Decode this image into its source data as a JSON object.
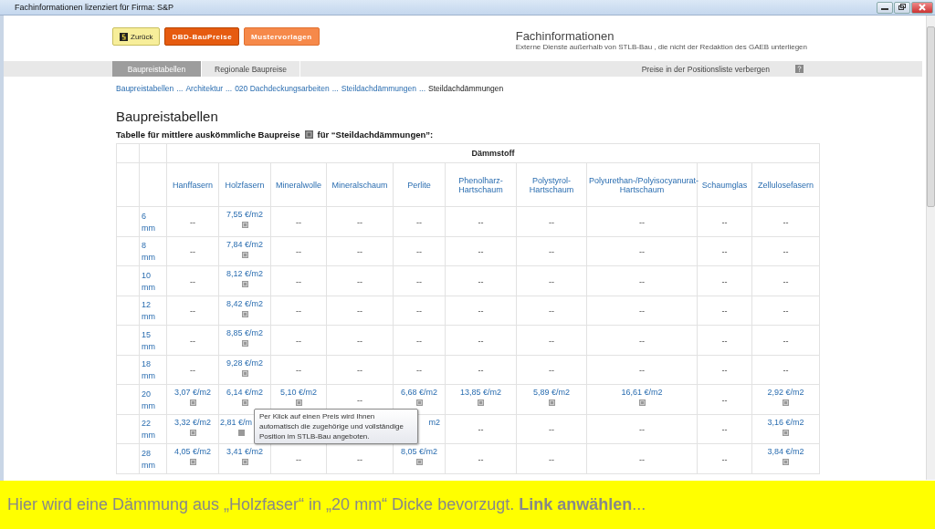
{
  "window": {
    "title": "Fachinformationen lizenziert für Firma: S&P"
  },
  "header_buttons": [
    {
      "label": "Zurück",
      "kind": "back"
    },
    {
      "label": "DBD-BauPreise",
      "kind": "primary"
    },
    {
      "label": "Mustervorlagen",
      "kind": "secondary"
    }
  ],
  "header": {
    "title": "Fachinformationen",
    "subtitle": "Externe Dienste außerhalb von  STLB-Bau , die nicht der Redaktion des GAEB unterliegen"
  },
  "tabs": [
    {
      "label": "Baupreistabellen",
      "selected": true
    },
    {
      "label": "Regionale Baupreise",
      "selected": false
    }
  ],
  "toggle_link": "Preise in der Positionsliste verbergen",
  "breadcrumb": [
    {
      "kind": "link",
      "text": "Baupreistabellen"
    },
    {
      "kind": "sep",
      "text": "..."
    },
    {
      "kind": "link",
      "text": "Architektur"
    },
    {
      "kind": "sep",
      "text": "..."
    },
    {
      "kind": "link",
      "text": "020 Dachdeckungsarbeiten"
    },
    {
      "kind": "sep",
      "text": "..."
    },
    {
      "kind": "link",
      "text": "Steildachdämmungen"
    },
    {
      "kind": "sep",
      "text": "..."
    },
    {
      "kind": "current",
      "text": "Steildachdämmungen"
    }
  ],
  "heading": "Baupreistabellen",
  "caption": {
    "before": "Tabelle für mittlere auskömmliche Baupreise",
    "after": "für “Steildachdämmungen”:"
  },
  "table": {
    "group_header": "Dämmstoff",
    "columns": [
      "Hanffasern",
      "Holzfasern",
      "Mineralwolle",
      "Mineralschaum",
      "Perlite",
      "Phenolharz-Hartschaum",
      "Polystyrol-Hartschaum",
      "Polyurethan-/Polyisocyanurat-Hartschaum",
      "Schaumglas",
      "Zellulosefasern"
    ],
    "rows": [
      {
        "size": "6",
        "unit": "mm",
        "cells": [
          {
            "kind": "dash",
            "text": "--"
          },
          {
            "kind": "price",
            "text": "7,55 €/m2",
            "info": true
          },
          {
            "kind": "dash",
            "text": "--"
          },
          {
            "kind": "dash",
            "text": "--"
          },
          {
            "kind": "dash",
            "text": "--"
          },
          {
            "kind": "dash",
            "text": "--"
          },
          {
            "kind": "dash",
            "text": "--"
          },
          {
            "kind": "dash",
            "text": "--"
          },
          {
            "kind": "dash",
            "text": "--"
          },
          {
            "kind": "dash",
            "text": "--"
          }
        ]
      },
      {
        "size": "8",
        "unit": "mm",
        "cells": [
          {
            "kind": "dash",
            "text": "--"
          },
          {
            "kind": "price",
            "text": "7,84 €/m2",
            "info": true
          },
          {
            "kind": "dash",
            "text": "--"
          },
          {
            "kind": "dash",
            "text": "--"
          },
          {
            "kind": "dash",
            "text": "--"
          },
          {
            "kind": "dash",
            "text": "--"
          },
          {
            "kind": "dash",
            "text": "--"
          },
          {
            "kind": "dash",
            "text": "--"
          },
          {
            "kind": "dash",
            "text": "--"
          },
          {
            "kind": "dash",
            "text": "--"
          }
        ]
      },
      {
        "size": "10",
        "unit": "mm",
        "cells": [
          {
            "kind": "dash",
            "text": "--"
          },
          {
            "kind": "price",
            "text": "8,12 €/m2",
            "info": true
          },
          {
            "kind": "dash",
            "text": "--"
          },
          {
            "kind": "dash",
            "text": "--"
          },
          {
            "kind": "dash",
            "text": "--"
          },
          {
            "kind": "dash",
            "text": "--"
          },
          {
            "kind": "dash",
            "text": "--"
          },
          {
            "kind": "dash",
            "text": "--"
          },
          {
            "kind": "dash",
            "text": "--"
          },
          {
            "kind": "dash",
            "text": "--"
          }
        ]
      },
      {
        "size": "12",
        "unit": "mm",
        "cells": [
          {
            "kind": "dash",
            "text": "--"
          },
          {
            "kind": "price",
            "text": "8,42 €/m2",
            "info": true
          },
          {
            "kind": "dash",
            "text": "--"
          },
          {
            "kind": "dash",
            "text": "--"
          },
          {
            "kind": "dash",
            "text": "--"
          },
          {
            "kind": "dash",
            "text": "--"
          },
          {
            "kind": "dash",
            "text": "--"
          },
          {
            "kind": "dash",
            "text": "--"
          },
          {
            "kind": "dash",
            "text": "--"
          },
          {
            "kind": "dash",
            "text": "--"
          }
        ]
      },
      {
        "size": "15",
        "unit": "mm",
        "cells": [
          {
            "kind": "dash",
            "text": "--"
          },
          {
            "kind": "price",
            "text": "8,85 €/m2",
            "info": true
          },
          {
            "kind": "dash",
            "text": "--"
          },
          {
            "kind": "dash",
            "text": "--"
          },
          {
            "kind": "dash",
            "text": "--"
          },
          {
            "kind": "dash",
            "text": "--"
          },
          {
            "kind": "dash",
            "text": "--"
          },
          {
            "kind": "dash",
            "text": "--"
          },
          {
            "kind": "dash",
            "text": "--"
          },
          {
            "kind": "dash",
            "text": "--"
          }
        ]
      },
      {
        "size": "18",
        "unit": "mm",
        "cells": [
          {
            "kind": "dash",
            "text": "--"
          },
          {
            "kind": "price",
            "text": "9,28 €/m2",
            "info": true
          },
          {
            "kind": "dash",
            "text": "--"
          },
          {
            "kind": "dash",
            "text": "--"
          },
          {
            "kind": "dash",
            "text": "--"
          },
          {
            "kind": "dash",
            "text": "--"
          },
          {
            "kind": "dash",
            "text": "--"
          },
          {
            "kind": "dash",
            "text": "--"
          },
          {
            "kind": "dash",
            "text": "--"
          },
          {
            "kind": "dash",
            "text": "--"
          }
        ]
      },
      {
        "size": "20",
        "unit": "mm",
        "cells": [
          {
            "kind": "price",
            "text": "3,07 €/m2",
            "info": true
          },
          {
            "kind": "price",
            "text": "6,14 €/m2",
            "info": true
          },
          {
            "kind": "price",
            "text": "5,10 €/m2",
            "info": true
          },
          {
            "kind": "dash",
            "text": "--"
          },
          {
            "kind": "price",
            "text": "6,68 €/m2",
            "info": true
          },
          {
            "kind": "price",
            "text": "13,85 €/m2",
            "info": true
          },
          {
            "kind": "price",
            "text": "5,89 €/m2",
            "info": true
          },
          {
            "kind": "price",
            "text": "16,61 €/m2",
            "info": true
          },
          {
            "kind": "dash",
            "text": "--"
          },
          {
            "kind": "price",
            "text": "2,92 €/m2",
            "info": true
          }
        ]
      },
      {
        "size": "22",
        "unit": "mm",
        "cells": [
          {
            "kind": "price",
            "text": "3,32 €/m2",
            "info": true
          },
          {
            "kind": "cut_end",
            "text": "2,81 €/m",
            "info": true
          },
          {
            "kind": "hidden"
          },
          {
            "kind": "hidden"
          },
          {
            "kind": "cut_start",
            "text": "m2",
            "info": false
          },
          {
            "kind": "dash",
            "text": "--"
          },
          {
            "kind": "dash",
            "text": "--"
          },
          {
            "kind": "dash",
            "text": "--"
          },
          {
            "kind": "dash",
            "text": "--"
          },
          {
            "kind": "price",
            "text": "3,16 €/m2",
            "info": true
          }
        ]
      },
      {
        "size": "28",
        "unit": "mm",
        "cells": [
          {
            "kind": "price",
            "text": "4,05 €/m2",
            "info": true
          },
          {
            "kind": "price",
            "text": "3,41 €/m2",
            "info": true
          },
          {
            "kind": "dash",
            "text": "--"
          },
          {
            "kind": "dash",
            "text": "--"
          },
          {
            "kind": "price",
            "text": "8,05 €/m2",
            "info": true
          },
          {
            "kind": "dash",
            "text": "--"
          },
          {
            "kind": "dash",
            "text": "--"
          },
          {
            "kind": "dash",
            "text": "--"
          },
          {
            "kind": "dash",
            "text": "--"
          },
          {
            "kind": "price",
            "text": "3,84 €/m2",
            "info": true
          }
        ]
      }
    ]
  },
  "tooltip": {
    "text": "Per Klick auf einen Preis wird Ihnen automatisch die zugehörige und vollständige Position im STLB-Bau angeboten."
  },
  "banner": {
    "text": "Hier wird eine Dämmung aus „Holzfaser“ in „20 mm“ Dicke bevorzugt. **Link anwählen**..."
  }
}
